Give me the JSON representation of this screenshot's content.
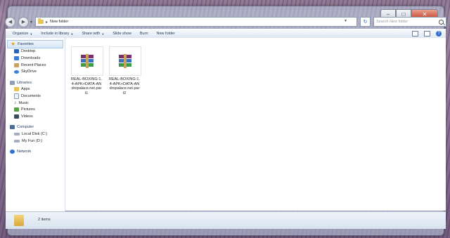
{
  "window": {
    "address_path": "New folder",
    "search_placeholder": "Search New folder",
    "caption": {
      "minimize": "–",
      "maximize": "□",
      "close": "✕"
    }
  },
  "toolbar": {
    "organize": "Organize",
    "include_in_library": "Include in library",
    "share_with": "Share with",
    "slide_show": "Slide show",
    "burn": "Burn",
    "new_folder": "New folder"
  },
  "nav": {
    "favorites": "Favorites",
    "desktop": "Desktop",
    "downloads": "Downloads",
    "recent_places": "Recent Places",
    "skydrive": "SkyDrive",
    "libraries": "Libraries",
    "apps": "Apps",
    "documents": "Documents",
    "music": "Music",
    "pictures": "Pictures",
    "videos": "Videos",
    "computer": "Computer",
    "local_disk": "Local Disk (C:)",
    "my_fun": "My Fun (D:)",
    "network": "Network"
  },
  "files": [
    {
      "name": "REAL-BOXING-1.4-APK+DATA-ANdropalace.net.part1",
      "icon": "winrar-archive-icon"
    },
    {
      "name": "REAL-BOXING-1.4-APK+DATA-ANdropalace.net.part2",
      "icon": "winrar-archive-icon"
    }
  ],
  "details": {
    "item_count": "2 items"
  }
}
